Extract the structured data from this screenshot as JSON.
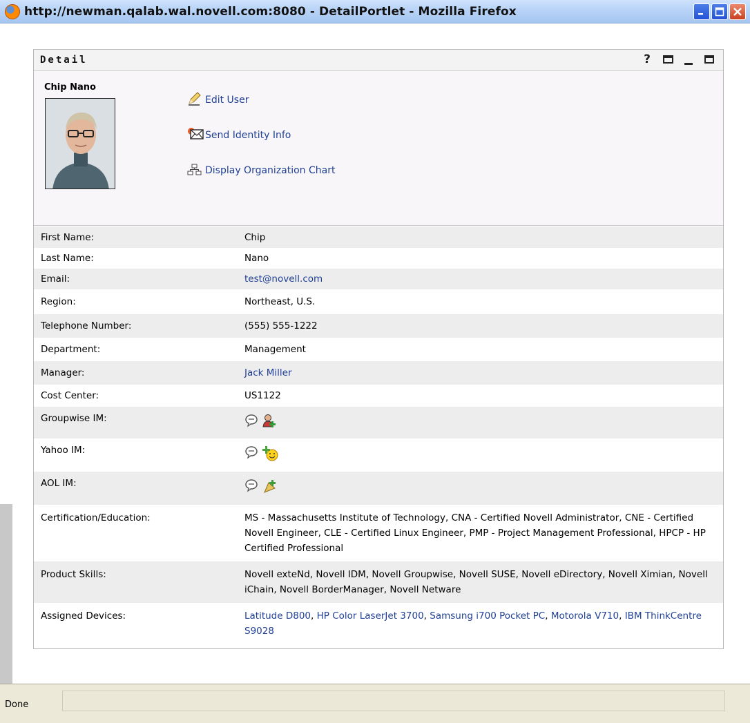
{
  "window": {
    "title": "http://newman.qalab.wal.novell.com:8080 - DetailPortlet - Mozilla Firefox",
    "buttons": [
      "minimize-icon",
      "maximize-icon",
      "close-icon"
    ]
  },
  "portlet": {
    "title": "Detail",
    "controls": {
      "help": "?"
    }
  },
  "profile": {
    "name": "Chip Nano",
    "actions": [
      {
        "label": "Edit User",
        "icon": "pencil-icon"
      },
      {
        "label": "Send Identity Info",
        "icon": "envelope-icon"
      },
      {
        "label": "Display Organization Chart",
        "icon": "org-chart-icon"
      }
    ]
  },
  "details": [
    {
      "label": "First Name:",
      "value": "Chip"
    },
    {
      "label": "Last Name:",
      "value": "Nano"
    },
    {
      "label": "Email:",
      "value": "test@novell.com",
      "link": true
    },
    {
      "label": "Region:",
      "value": "Northeast, U.S."
    },
    {
      "label": "Telephone Number:",
      "value": "(555) 555-1222"
    },
    {
      "label": "Department:",
      "value": "Management"
    },
    {
      "label": "Manager:",
      "value": "Jack Miller",
      "link": true
    },
    {
      "label": "Cost Center:",
      "value": "US1122"
    },
    {
      "label": "Groupwise IM:",
      "icons": [
        "chat-bubble-icon",
        "add-contact-icon"
      ]
    },
    {
      "label": "Yahoo IM:",
      "icons": [
        "chat-bubble-icon",
        "add-smiley-icon"
      ]
    },
    {
      "label": "AOL IM:",
      "icons": [
        "chat-bubble-icon",
        "add-buddy-icon"
      ]
    },
    {
      "label": "Certification/Education:",
      "value": "MS - Massachusetts Institute of Technology, CNA - Certified Novell Administrator, CNE - Certified Novell Engineer, CLE - Certified Linux Engineer, PMP - Project Management Professional, HPCP - HP Certified Professional"
    },
    {
      "label": "Product Skills:",
      "value": "Novell exteNd, Novell IDM, Novell Groupwise, Novell SUSE, Novell eDirectory, Novell Ximian, Novell iChain, Novell BorderManager, Novell Netware"
    },
    {
      "label": "Assigned Devices:",
      "devices": [
        "Latitude D800",
        "HP Color LaserJet 3700",
        "Samsung i700 Pocket PC",
        "Motorola V710",
        "IBM ThinkCentre S9028"
      ]
    }
  ],
  "status": {
    "text": "Done"
  },
  "colors": {
    "link": "#1f3f95",
    "titlebar": "#b9d4f7",
    "row_alt": "#ededed"
  }
}
